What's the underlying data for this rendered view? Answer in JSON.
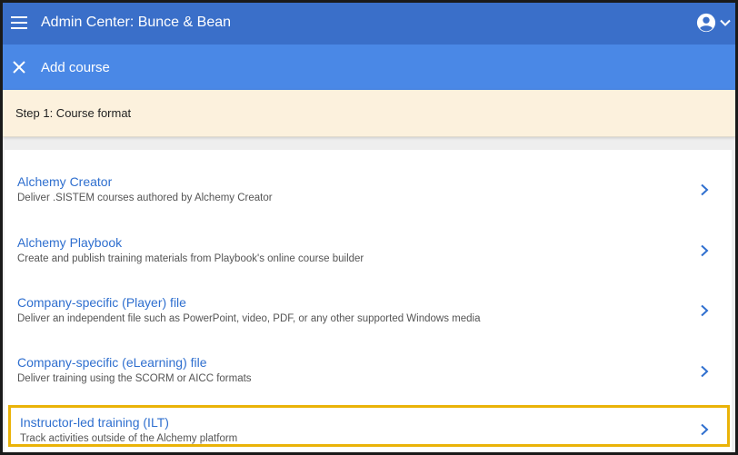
{
  "header": {
    "title": "Admin Center: Bunce & Bean",
    "menu_icon": "hamburger-menu-icon",
    "account_icon": "account-circle-icon"
  },
  "subheader": {
    "title": "Add course",
    "close_icon": "close-icon"
  },
  "step": {
    "label": "Step 1: Course format"
  },
  "options": [
    {
      "title": "Alchemy Creator",
      "description": "Deliver .SISTEM courses authored by Alchemy Creator"
    },
    {
      "title": "Alchemy Playbook",
      "description": "Create and publish training materials from Playbook's online course builder"
    },
    {
      "title": "Company-specific (Player) file",
      "description": "Deliver an independent file such as PowerPoint, video, PDF, or any other supported Windows media"
    },
    {
      "title": "Company-specific (eLearning) file",
      "description": "Deliver training using the SCORM or AICC formats"
    },
    {
      "title": "Instructor-led training (ILT)",
      "description": "Track activities outside of the Alchemy platform"
    }
  ],
  "colors": {
    "header": "#3a6fc9",
    "subheader": "#4a88e6",
    "step_bg": "#fcf1dd",
    "link": "#2f6fcf",
    "highlight": "#eab308"
  }
}
